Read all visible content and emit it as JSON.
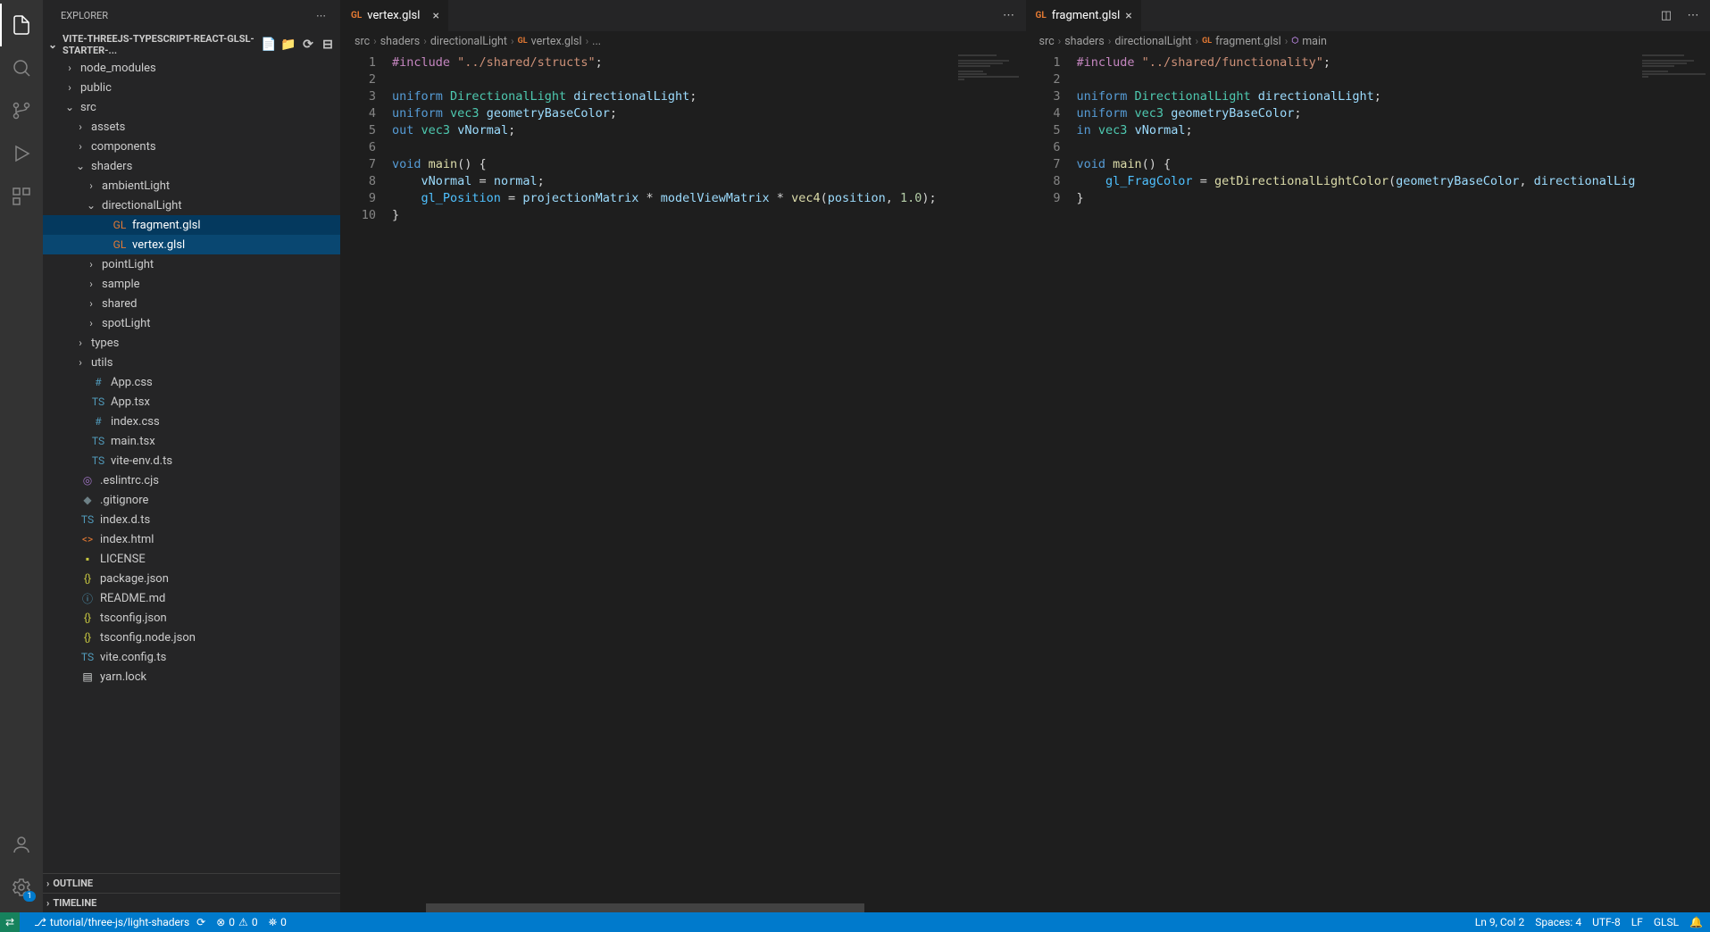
{
  "sidebar": {
    "title": "EXPLORER",
    "project": "VITE-THREEJS-TYPESCRIPT-REACT-GLSL-STARTER-...",
    "outline": "OUTLINE",
    "timeline": "TIMELINE"
  },
  "tree": [
    {
      "d": 1,
      "t": "folder",
      "open": false,
      "name": "node_modules"
    },
    {
      "d": 1,
      "t": "folder",
      "open": false,
      "name": "public"
    },
    {
      "d": 1,
      "t": "folder",
      "open": true,
      "name": "src"
    },
    {
      "d": 2,
      "t": "folder",
      "open": false,
      "name": "assets"
    },
    {
      "d": 2,
      "t": "folder",
      "open": false,
      "name": "components"
    },
    {
      "d": 2,
      "t": "folder",
      "open": true,
      "name": "shaders"
    },
    {
      "d": 3,
      "t": "folder",
      "open": false,
      "name": "ambientLight"
    },
    {
      "d": 3,
      "t": "folder",
      "open": true,
      "name": "directionalLight"
    },
    {
      "d": 4,
      "t": "file",
      "icon": "GL",
      "cls": "orange",
      "name": "fragment.glsl",
      "sel": "selected"
    },
    {
      "d": 4,
      "t": "file",
      "icon": "GL",
      "cls": "orange",
      "name": "vertex.glsl",
      "sel": "selected-b"
    },
    {
      "d": 3,
      "t": "folder",
      "open": false,
      "name": "pointLight"
    },
    {
      "d": 3,
      "t": "folder",
      "open": false,
      "name": "sample"
    },
    {
      "d": 3,
      "t": "folder",
      "open": false,
      "name": "shared"
    },
    {
      "d": 3,
      "t": "folder",
      "open": false,
      "name": "spotLight"
    },
    {
      "d": 2,
      "t": "folder",
      "open": false,
      "name": "types"
    },
    {
      "d": 2,
      "t": "folder",
      "open": false,
      "name": "utils"
    },
    {
      "d": 2,
      "t": "file",
      "icon": "#",
      "cls": "blue",
      "name": "App.css"
    },
    {
      "d": 2,
      "t": "file",
      "icon": "TS",
      "cls": "blue",
      "name": "App.tsx"
    },
    {
      "d": 2,
      "t": "file",
      "icon": "#",
      "cls": "blue",
      "name": "index.css"
    },
    {
      "d": 2,
      "t": "file",
      "icon": "TS",
      "cls": "blue",
      "name": "main.tsx"
    },
    {
      "d": 2,
      "t": "file",
      "icon": "TS",
      "cls": "blue",
      "name": "vite-env.d.ts"
    },
    {
      "d": 1,
      "t": "file",
      "icon": "◎",
      "cls": "purple",
      "name": ".eslintrc.cjs"
    },
    {
      "d": 1,
      "t": "file",
      "icon": "◆",
      "cls": "gray",
      "name": ".gitignore"
    },
    {
      "d": 1,
      "t": "file",
      "icon": "TS",
      "cls": "blue",
      "name": "index.d.ts"
    },
    {
      "d": 1,
      "t": "file",
      "icon": "<>",
      "cls": "orange",
      "name": "index.html"
    },
    {
      "d": 1,
      "t": "file",
      "icon": "▪",
      "cls": "yellow",
      "name": "LICENSE"
    },
    {
      "d": 1,
      "t": "file",
      "icon": "{}",
      "cls": "yellow",
      "name": "package.json"
    },
    {
      "d": 1,
      "t": "file",
      "icon": "ⓘ",
      "cls": "blue",
      "name": "README.md"
    },
    {
      "d": 1,
      "t": "file",
      "icon": "{}",
      "cls": "yellow",
      "name": "tsconfig.json"
    },
    {
      "d": 1,
      "t": "file",
      "icon": "{}",
      "cls": "yellow",
      "name": "tsconfig.node.json"
    },
    {
      "d": 1,
      "t": "file",
      "icon": "TS",
      "cls": "blue",
      "name": "vite.config.ts"
    },
    {
      "d": 1,
      "t": "file",
      "icon": "▤",
      "cls": "white",
      "name": "yarn.lock"
    }
  ],
  "editor1": {
    "tab": "vertex.glsl",
    "breadcrumb": [
      "src",
      "shaders",
      "directionalLight",
      "vertex.glsl",
      "..."
    ],
    "breadcrumb_icon_at": 3,
    "code": [
      [
        [
          "macro",
          "#include"
        ],
        [
          "punct",
          " "
        ],
        [
          "str",
          "\"../shared/structs\""
        ],
        [
          "punct",
          ";"
        ]
      ],
      [],
      [
        [
          "kw",
          "uniform"
        ],
        [
          "punct",
          " "
        ],
        [
          "type",
          "DirectionalLight"
        ],
        [
          "punct",
          " "
        ],
        [
          "ident",
          "directionalLight"
        ],
        [
          "punct",
          ";"
        ]
      ],
      [
        [
          "kw",
          "uniform"
        ],
        [
          "punct",
          " "
        ],
        [
          "type",
          "vec3"
        ],
        [
          "punct",
          " "
        ],
        [
          "ident",
          "geometryBaseColor"
        ],
        [
          "punct",
          ";"
        ]
      ],
      [
        [
          "kw",
          "out"
        ],
        [
          "punct",
          " "
        ],
        [
          "type",
          "vec3"
        ],
        [
          "punct",
          " "
        ],
        [
          "ident",
          "vNormal"
        ],
        [
          "punct",
          ";"
        ]
      ],
      [],
      [
        [
          "kw",
          "void"
        ],
        [
          "punct",
          " "
        ],
        [
          "func",
          "main"
        ],
        [
          "punct",
          "() {"
        ]
      ],
      [
        [
          "punct",
          "    "
        ],
        [
          "ident",
          "vNormal"
        ],
        [
          "punct",
          " = "
        ],
        [
          "ident",
          "normal"
        ],
        [
          "punct",
          ";"
        ]
      ],
      [
        [
          "punct",
          "    "
        ],
        [
          "builtin",
          "gl_Position"
        ],
        [
          "punct",
          " = "
        ],
        [
          "ident",
          "projectionMatrix"
        ],
        [
          "punct",
          " * "
        ],
        [
          "ident",
          "modelViewMatrix"
        ],
        [
          "punct",
          " * "
        ],
        [
          "func",
          "vec4"
        ],
        [
          "punct",
          "("
        ],
        [
          "ident",
          "position"
        ],
        [
          "punct",
          ", "
        ],
        [
          "num",
          "1.0"
        ],
        [
          "punct",
          ");"
        ]
      ],
      [
        [
          "punct",
          "}"
        ]
      ]
    ]
  },
  "editor2": {
    "tab": "fragment.glsl",
    "breadcrumb": [
      "src",
      "shaders",
      "directionalLight",
      "fragment.glsl",
      "main"
    ],
    "breadcrumb_icon_at": 3,
    "breadcrumb_sym_at": 4,
    "code": [
      [
        [
          "macro",
          "#include"
        ],
        [
          "punct",
          " "
        ],
        [
          "str",
          "\"../shared/functionality\""
        ],
        [
          "punct",
          ";"
        ]
      ],
      [],
      [
        [
          "kw",
          "uniform"
        ],
        [
          "punct",
          " "
        ],
        [
          "type",
          "DirectionalLight"
        ],
        [
          "punct",
          " "
        ],
        [
          "ident",
          "directionalLight"
        ],
        [
          "punct",
          ";"
        ]
      ],
      [
        [
          "kw",
          "uniform"
        ],
        [
          "punct",
          " "
        ],
        [
          "type",
          "vec3"
        ],
        [
          "punct",
          " "
        ],
        [
          "ident",
          "geometryBaseColor"
        ],
        [
          "punct",
          ";"
        ]
      ],
      [
        [
          "kw",
          "in"
        ],
        [
          "punct",
          " "
        ],
        [
          "type",
          "vec3"
        ],
        [
          "punct",
          " "
        ],
        [
          "ident",
          "vNormal"
        ],
        [
          "punct",
          ";"
        ]
      ],
      [],
      [
        [
          "kw",
          "void"
        ],
        [
          "punct",
          " "
        ],
        [
          "func",
          "main"
        ],
        [
          "punct",
          "() {"
        ]
      ],
      [
        [
          "punct",
          "    "
        ],
        [
          "builtin",
          "gl_FragColor"
        ],
        [
          "punct",
          " = "
        ],
        [
          "func",
          "getDirectionalLightColor"
        ],
        [
          "punct",
          "("
        ],
        [
          "ident",
          "geometryBaseColor"
        ],
        [
          "punct",
          ", "
        ],
        [
          "ident",
          "directionalLig"
        ]
      ],
      [
        [
          "punct",
          "}"
        ]
      ]
    ]
  },
  "statusbar": {
    "branch": "tutorial/three-js/light-shaders",
    "errors": "0",
    "warnings": "0",
    "ports": "0",
    "lncol": "Ln 9, Col 2",
    "spaces": "Spaces: 4",
    "encoding": "UTF-8",
    "eol": "LF",
    "lang": "GLSL"
  },
  "badges": {
    "settings": "1"
  }
}
